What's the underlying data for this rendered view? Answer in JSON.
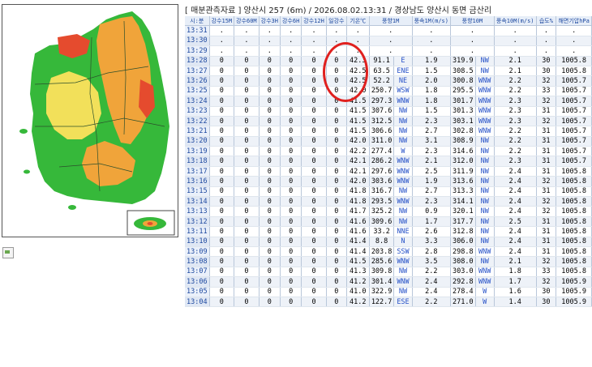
{
  "header": {
    "title": "[ 매분관측자료 ] 양산시 257 (6m) / 2026.08.02.13:31 / 경상남도 양산시 동면 금산리"
  },
  "table": {
    "columns": [
      "시:분",
      "강수15M",
      "강수60M",
      "강수3H",
      "강수6H",
      "강수12H",
      "일강수",
      "기온℃",
      "풍향1M",
      "풍속1M(m/s)",
      "풍향10M",
      "풍속10M(m/s)",
      "습도%",
      "해면기압hPa"
    ],
    "rows": [
      [
        "13:31",
        ".",
        ".",
        ".",
        ".",
        ".",
        ".",
        ".",
        ".",
        ".",
        ".",
        ".",
        ".",
        "."
      ],
      [
        "13:30",
        ".",
        ".",
        ".",
        ".",
        ".",
        ".",
        ".",
        ".",
        ".",
        ".",
        ".",
        ".",
        "."
      ],
      [
        "13:29",
        ".",
        ".",
        ".",
        ".",
        ".",
        ".",
        ".",
        ".",
        ".",
        ".",
        ".",
        ".",
        "."
      ],
      [
        "13:28",
        "0",
        "0",
        "0",
        "0",
        "0",
        "0",
        "42.3",
        "91.1",
        "E",
        "1.9",
        "319.9",
        "NW",
        "2.1",
        "30",
        "1005.8"
      ],
      [
        "13:27",
        "0",
        "0",
        "0",
        "0",
        "0",
        "0",
        "42.5",
        "63.5",
        "ENE",
        "1.5",
        "308.5",
        "NW",
        "2.1",
        "30",
        "1005.8"
      ],
      [
        "13:26",
        "0",
        "0",
        "0",
        "0",
        "0",
        "0",
        "42.5",
        "52.2",
        "NE",
        "2.0",
        "300.8",
        "WNW",
        "2.2",
        "32",
        "1005.7"
      ],
      [
        "13:25",
        "0",
        "0",
        "0",
        "0",
        "0",
        "0",
        "42.0",
        "250.7",
        "WSW",
        "1.8",
        "295.5",
        "WNW",
        "2.2",
        "33",
        "1005.7"
      ],
      [
        "13:24",
        "0",
        "0",
        "0",
        "0",
        "0",
        "0",
        "41.5",
        "297.3",
        "WNW",
        "1.8",
        "301.7",
        "WNW",
        "2.3",
        "32",
        "1005.7"
      ],
      [
        "13:23",
        "0",
        "0",
        "0",
        "0",
        "0",
        "0",
        "41.5",
        "307.6",
        "NW",
        "1.5",
        "301.3",
        "WNW",
        "2.3",
        "31",
        "1005.7"
      ],
      [
        "13:22",
        "0",
        "0",
        "0",
        "0",
        "0",
        "0",
        "41.5",
        "312.5",
        "NW",
        "2.3",
        "303.1",
        "WNW",
        "2.3",
        "32",
        "1005.7"
      ],
      [
        "13:21",
        "0",
        "0",
        "0",
        "0",
        "0",
        "0",
        "41.5",
        "306.6",
        "NW",
        "2.7",
        "302.8",
        "WNW",
        "2.2",
        "31",
        "1005.7"
      ],
      [
        "13:20",
        "0",
        "0",
        "0",
        "0",
        "0",
        "0",
        "42.0",
        "311.0",
        "NW",
        "3.1",
        "308.9",
        "NW",
        "2.2",
        "31",
        "1005.7"
      ],
      [
        "13:19",
        "0",
        "0",
        "0",
        "0",
        "0",
        "0",
        "42.2",
        "277.4",
        "W",
        "2.3",
        "314.6",
        "NW",
        "2.2",
        "31",
        "1005.7"
      ],
      [
        "13:18",
        "0",
        "0",
        "0",
        "0",
        "0",
        "0",
        "42.1",
        "286.2",
        "WNW",
        "2.1",
        "312.0",
        "NW",
        "2.3",
        "31",
        "1005.7"
      ],
      [
        "13:17",
        "0",
        "0",
        "0",
        "0",
        "0",
        "0",
        "42.1",
        "297.6",
        "WNW",
        "2.5",
        "311.9",
        "NW",
        "2.4",
        "31",
        "1005.8"
      ],
      [
        "13:16",
        "0",
        "0",
        "0",
        "0",
        "0",
        "0",
        "42.0",
        "303.6",
        "WNW",
        "1.9",
        "313.6",
        "NW",
        "2.4",
        "32",
        "1005.8"
      ],
      [
        "13:15",
        "0",
        "0",
        "0",
        "0",
        "0",
        "0",
        "41.8",
        "316.7",
        "NW",
        "2.7",
        "313.3",
        "NW",
        "2.4",
        "31",
        "1005.8"
      ],
      [
        "13:14",
        "0",
        "0",
        "0",
        "0",
        "0",
        "0",
        "41.8",
        "293.5",
        "WNW",
        "2.3",
        "314.1",
        "NW",
        "2.4",
        "32",
        "1005.8"
      ],
      [
        "13:13",
        "0",
        "0",
        "0",
        "0",
        "0",
        "0",
        "41.7",
        "325.2",
        "NW",
        "0.9",
        "320.1",
        "NW",
        "2.4",
        "32",
        "1005.8"
      ],
      [
        "13:12",
        "0",
        "0",
        "0",
        "0",
        "0",
        "0",
        "41.6",
        "309.6",
        "NW",
        "1.7",
        "317.7",
        "NW",
        "2.5",
        "31",
        "1005.8"
      ],
      [
        "13:11",
        "0",
        "0",
        "0",
        "0",
        "0",
        "0",
        "41.6",
        "33.2",
        "NNE",
        "2.6",
        "312.8",
        "NW",
        "2.4",
        "31",
        "1005.8"
      ],
      [
        "13:10",
        "0",
        "0",
        "0",
        "0",
        "0",
        "0",
        "41.4",
        "8.8",
        "N",
        "3.3",
        "306.0",
        "NW",
        "2.4",
        "31",
        "1005.8"
      ],
      [
        "13:09",
        "0",
        "0",
        "0",
        "0",
        "0",
        "0",
        "41.4",
        "203.8",
        "SSW",
        "2.8",
        "298.8",
        "WNW",
        "2.4",
        "31",
        "1005.8"
      ],
      [
        "13:08",
        "0",
        "0",
        "0",
        "0",
        "0",
        "0",
        "41.5",
        "285.6",
        "WNW",
        "3.5",
        "308.0",
        "NW",
        "2.1",
        "32",
        "1005.8"
      ],
      [
        "13:07",
        "0",
        "0",
        "0",
        "0",
        "0",
        "0",
        "41.3",
        "309.8",
        "NW",
        "2.2",
        "303.0",
        "WNW",
        "1.8",
        "33",
        "1005.8"
      ],
      [
        "13:06",
        "0",
        "0",
        "0",
        "0",
        "0",
        "0",
        "41.2",
        "301.4",
        "WNW",
        "2.4",
        "292.8",
        "WNW",
        "1.7",
        "32",
        "1005.9"
      ],
      [
        "13:05",
        "0",
        "0",
        "0",
        "0",
        "0",
        "0",
        "41.0",
        "322.9",
        "NW",
        "2.4",
        "278.4",
        "W",
        "1.6",
        "30",
        "1005.9"
      ],
      [
        "13:04",
        "0",
        "0",
        "0",
        "0",
        "0",
        "0",
        "41.2",
        "122.7",
        "ESE",
        "2.2",
        "271.0",
        "W",
        "1.4",
        "30",
        "1005.9"
      ]
    ]
  },
  "colors": {
    "header_bg": "#e7eef8",
    "header_text": "#1f4aa0",
    "direction_text": "#2752c8",
    "annotation_circle": "#e0201e"
  }
}
